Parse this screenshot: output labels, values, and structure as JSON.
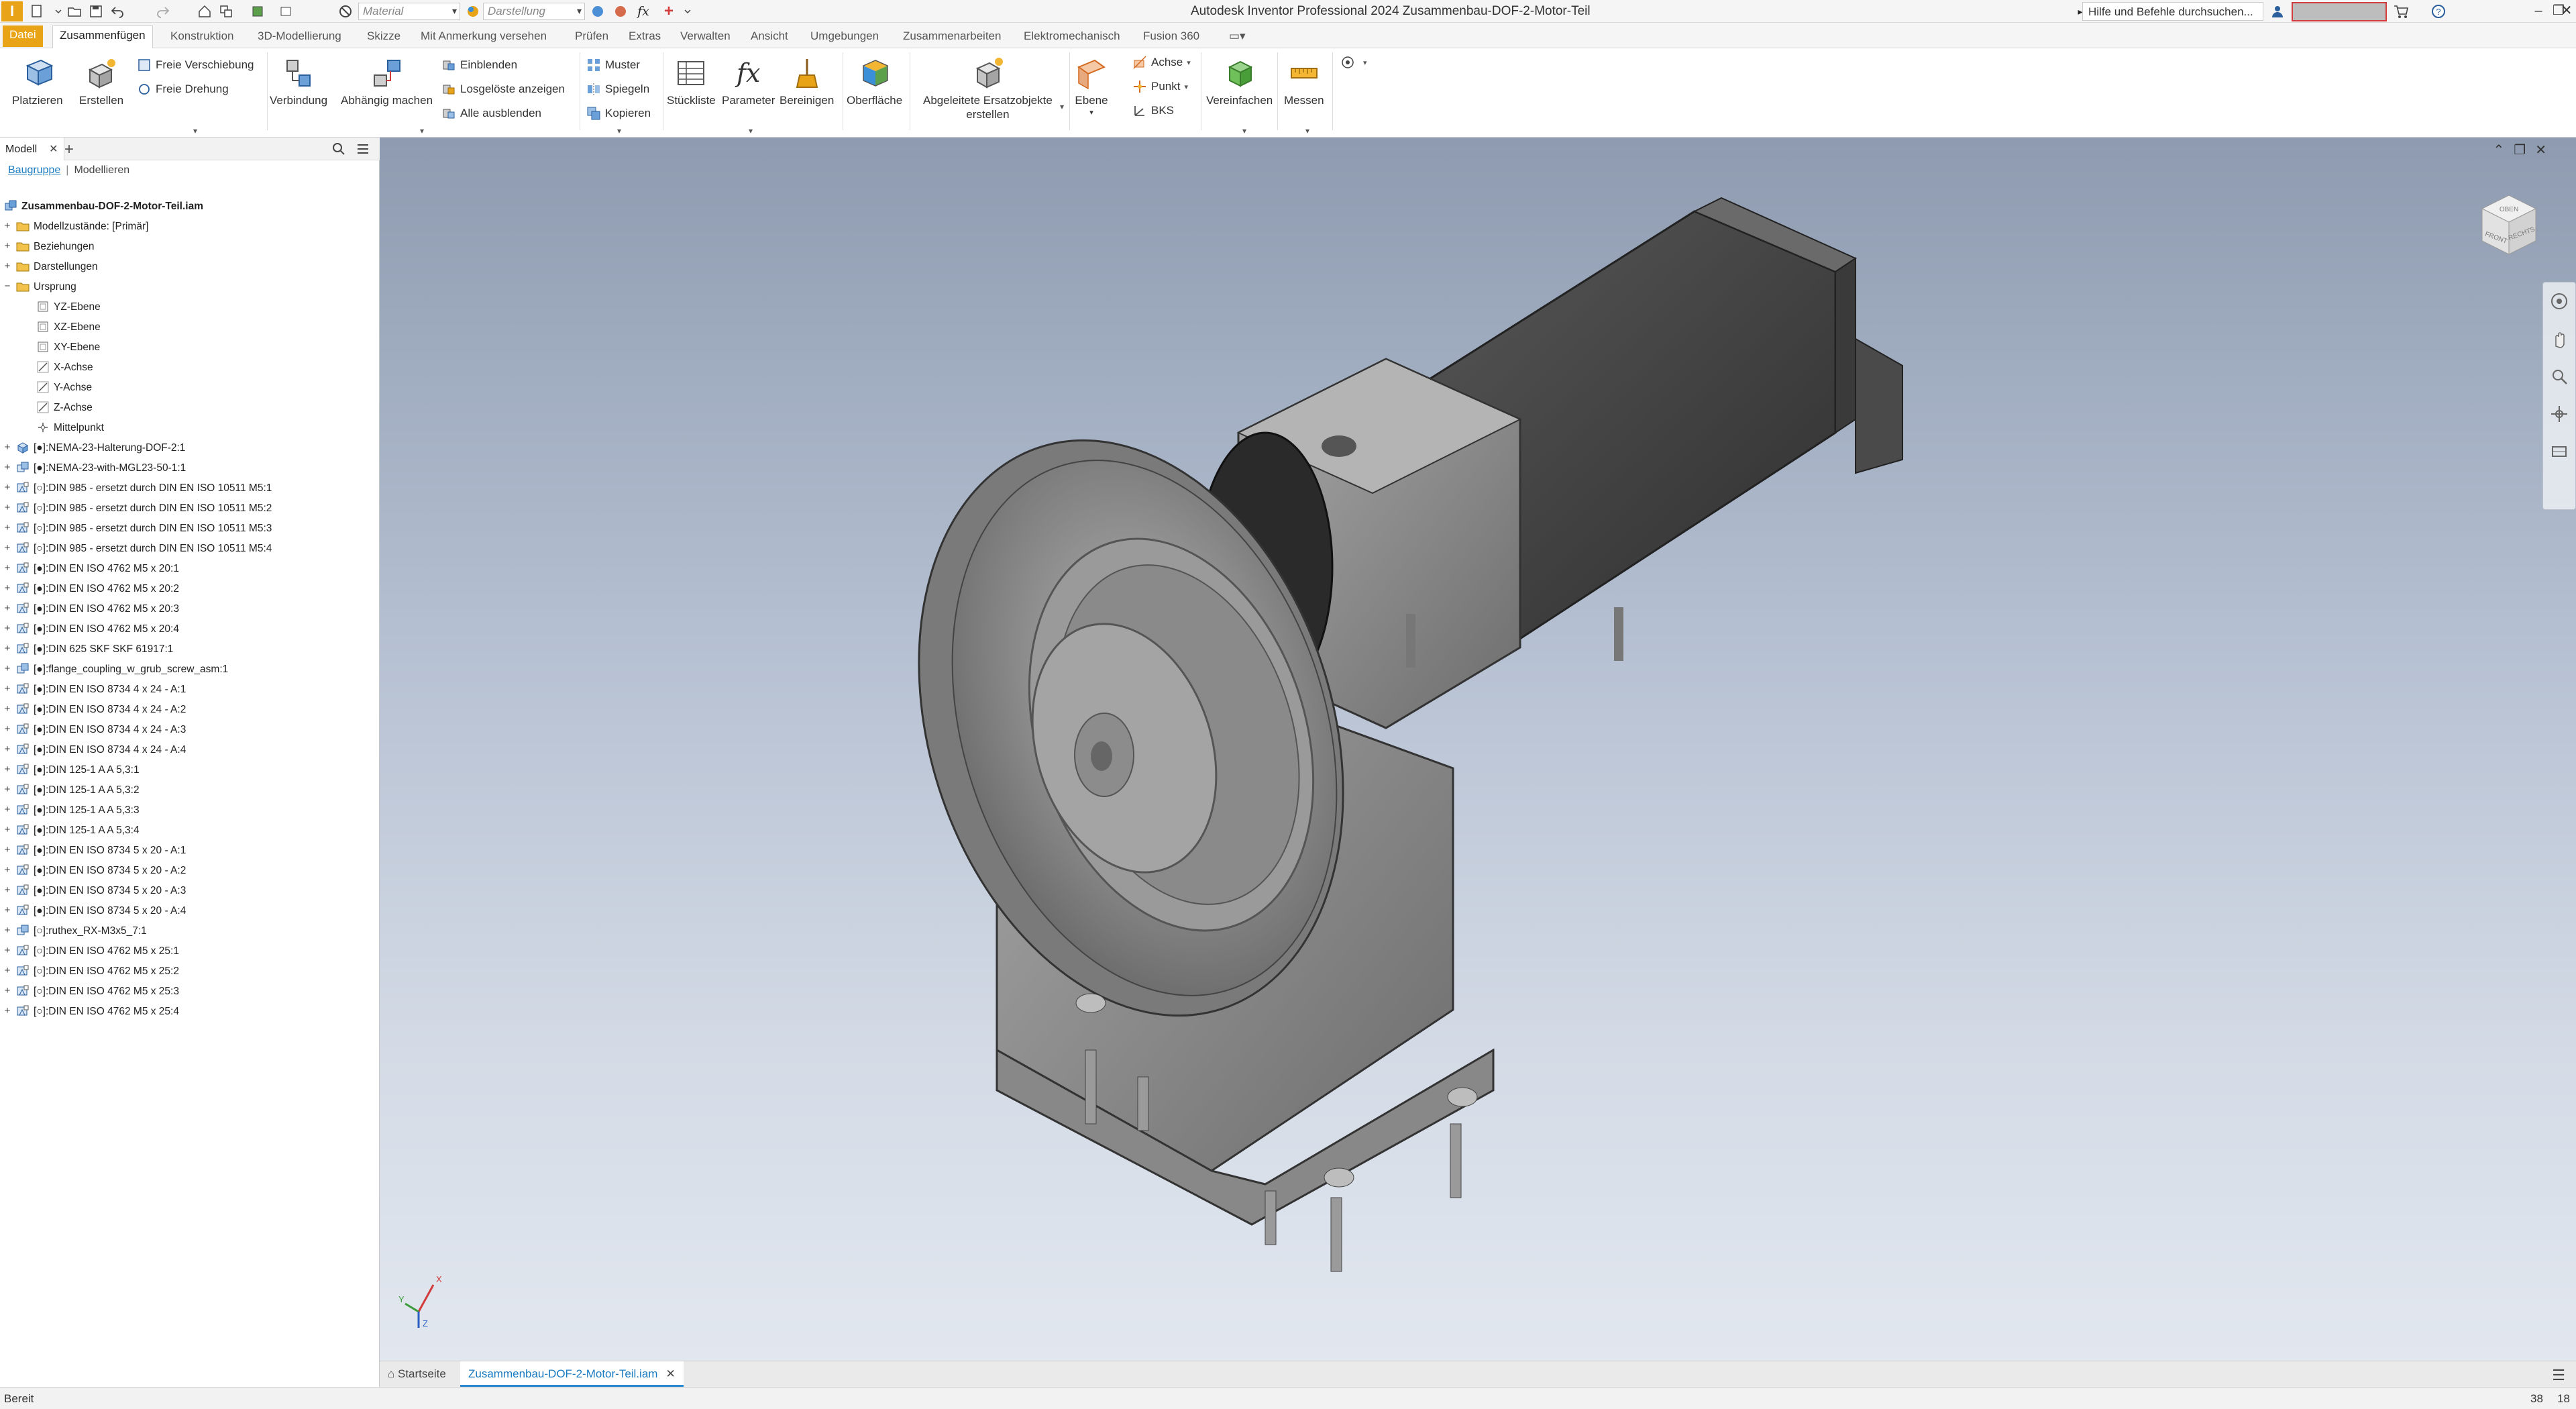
{
  "app": {
    "logo_letter": "I",
    "window_title": "Autodesk Inventor Professional 2024   Zusammenbau-DOF-2-Motor-Teil",
    "material_combo": "Material",
    "appearance_combo": "Darstellung",
    "help_search_placeholder": "Hilfe und Befehle durchsuchen...",
    "accent_color": "#e8a317"
  },
  "tabs": [
    "Datei",
    "Zusammenfügen",
    "Konstruktion",
    "3D-Modellierung",
    "Skizze",
    "Mit Anmerkung versehen",
    "Prüfen",
    "Extras",
    "Verwalten",
    "Ansicht",
    "Umgebungen",
    "Zusammenarbeiten",
    "Elektromechanisch",
    "Fusion 360"
  ],
  "active_tab": "Zusammenfügen",
  "ribbon": {
    "platzieren": "Platzieren",
    "erstellen": "Erstellen",
    "freie_verschiebung": "Freie Verschiebung",
    "freie_drehung": "Freie Drehung",
    "verbindung": "Verbindung",
    "abhaengig_machen": "Abhängig machen",
    "einblenden": "Einblenden",
    "losgeloeste": "Losgelöste anzeigen",
    "alle_ausblenden": "Alle ausblenden",
    "muster": "Muster",
    "spiegeln": "Spiegeln",
    "kopieren": "Kopieren",
    "stueckliste": "Stückliste",
    "parameter": "Parameter",
    "bereinigen": "Bereinigen",
    "oberflaeche": "Oberfläche",
    "ersatz_line1": "Abgeleitete Ersatzobjekte",
    "ersatz_line2": "erstellen",
    "ebene": "Ebene",
    "achse": "Achse",
    "punkt": "Punkt",
    "bks": "BKS",
    "vereinfachen": "Vereinfachen",
    "messen": "Messen"
  },
  "browser": {
    "tab_label": "Modell",
    "sub_baugruppe": "Baugruppe",
    "sub_modellieren": "Modellieren",
    "tree": [
      {
        "label": "Zusammenbau-DOF-2-Motor-Teil.iam",
        "level": 0,
        "icon": "assembly-icon",
        "exp": ""
      },
      {
        "label": "Modellzustände: [Primär]",
        "level": 1,
        "icon": "folder-icon",
        "exp": "+"
      },
      {
        "label": "Beziehungen",
        "level": 1,
        "icon": "folder-icon",
        "exp": "+"
      },
      {
        "label": "Darstellungen",
        "level": 1,
        "icon": "folder-icon",
        "exp": "+"
      },
      {
        "label": "Ursprung",
        "level": 1,
        "icon": "folder-icon",
        "exp": "−"
      },
      {
        "label": "YZ-Ebene",
        "level": 2,
        "icon": "plane-icon",
        "exp": ""
      },
      {
        "label": "XZ-Ebene",
        "level": 2,
        "icon": "plane-icon",
        "exp": ""
      },
      {
        "label": "XY-Ebene",
        "level": 2,
        "icon": "plane-icon",
        "exp": ""
      },
      {
        "label": "X-Achse",
        "level": 2,
        "icon": "axis-icon",
        "exp": ""
      },
      {
        "label": "Y-Achse",
        "level": 2,
        "icon": "axis-icon",
        "exp": ""
      },
      {
        "label": "Z-Achse",
        "level": 2,
        "icon": "axis-icon",
        "exp": ""
      },
      {
        "label": "Mittelpunkt",
        "level": 2,
        "icon": "point-icon",
        "exp": ""
      },
      {
        "label": "[●]:NEMA-23-Halterung-DOF-2:1",
        "level": 1,
        "icon": "part-icon",
        "exp": "+"
      },
      {
        "label": "[●]:NEMA-23-with-MGL23-50-1:1",
        "level": 1,
        "icon": "subassembly-icon",
        "exp": "+"
      },
      {
        "label": "[○]:DIN 985 - ersetzt durch DIN EN ISO 10511 M5:1",
        "level": 1,
        "icon": "library-part-icon",
        "exp": "+"
      },
      {
        "label": "[○]:DIN 985 - ersetzt durch DIN EN ISO 10511 M5:2",
        "level": 1,
        "icon": "library-part-icon",
        "exp": "+"
      },
      {
        "label": "[○]:DIN 985 - ersetzt durch DIN EN ISO 10511 M5:3",
        "level": 1,
        "icon": "library-part-icon",
        "exp": "+"
      },
      {
        "label": "[○]:DIN 985 - ersetzt durch DIN EN ISO 10511 M5:4",
        "level": 1,
        "icon": "library-part-icon",
        "exp": "+"
      },
      {
        "label": "[●]:DIN EN ISO 4762 M5 x 20:1",
        "level": 1,
        "icon": "library-part-icon",
        "exp": "+"
      },
      {
        "label": "[●]:DIN EN ISO 4762 M5 x 20:2",
        "level": 1,
        "icon": "library-part-icon",
        "exp": "+"
      },
      {
        "label": "[●]:DIN EN ISO 4762 M5 x 20:3",
        "level": 1,
        "icon": "library-part-icon",
        "exp": "+"
      },
      {
        "label": "[●]:DIN EN ISO 4762 M5 x 20:4",
        "level": 1,
        "icon": "library-part-icon",
        "exp": "+"
      },
      {
        "label": "[●]:DIN 625 SKF SKF 61917:1",
        "level": 1,
        "icon": "library-part-icon",
        "exp": "+"
      },
      {
        "label": "[●]:flange_coupling_w_grub_screw_asm:1",
        "level": 1,
        "icon": "subassembly-icon",
        "exp": "+"
      },
      {
        "label": "[●]:DIN EN ISO 8734 4 x 24 - A:1",
        "level": 1,
        "icon": "library-part-icon",
        "exp": "+"
      },
      {
        "label": "[●]:DIN EN ISO 8734 4 x 24 - A:2",
        "level": 1,
        "icon": "library-part-icon",
        "exp": "+"
      },
      {
        "label": "[●]:DIN EN ISO 8734 4 x 24 - A:3",
        "level": 1,
        "icon": "library-part-icon",
        "exp": "+"
      },
      {
        "label": "[●]:DIN EN ISO 8734 4 x 24 - A:4",
        "level": 1,
        "icon": "library-part-icon",
        "exp": "+"
      },
      {
        "label": "[●]:DIN 125-1 A A 5,3:1",
        "level": 1,
        "icon": "library-part-icon",
        "exp": "+"
      },
      {
        "label": "[●]:DIN 125-1 A A 5,3:2",
        "level": 1,
        "icon": "library-part-icon",
        "exp": "+"
      },
      {
        "label": "[●]:DIN 125-1 A A 5,3:3",
        "level": 1,
        "icon": "library-part-icon",
        "exp": "+"
      },
      {
        "label": "[●]:DIN 125-1 A A 5,3:4",
        "level": 1,
        "icon": "library-part-icon",
        "exp": "+"
      },
      {
        "label": "[●]:DIN EN ISO 8734 5 x 20 - A:1",
        "level": 1,
        "icon": "library-part-icon",
        "exp": "+"
      },
      {
        "label": "[●]:DIN EN ISO 8734 5 x 20 - A:2",
        "level": 1,
        "icon": "library-part-icon",
        "exp": "+"
      },
      {
        "label": "[●]:DIN EN ISO 8734 5 x 20 - A:3",
        "level": 1,
        "icon": "library-part-icon",
        "exp": "+"
      },
      {
        "label": "[●]:DIN EN ISO 8734 5 x 20 - A:4",
        "level": 1,
        "icon": "library-part-icon",
        "exp": "+"
      },
      {
        "label": "[○]:ruthex_RX-M3x5_7:1",
        "level": 1,
        "icon": "subassembly-icon",
        "exp": "+"
      },
      {
        "label": "[○]:DIN EN ISO 4762 M5 x 25:1",
        "level": 1,
        "icon": "library-part-icon",
        "exp": "+"
      },
      {
        "label": "[○]:DIN EN ISO 4762 M5 x 25:2",
        "level": 1,
        "icon": "library-part-icon",
        "exp": "+"
      },
      {
        "label": "[○]:DIN EN ISO 4762 M5 x 25:3",
        "level": 1,
        "icon": "library-part-icon",
        "exp": "+"
      },
      {
        "label": "[○]:DIN EN ISO 4762 M5 x 25:4",
        "level": 1,
        "icon": "library-part-icon",
        "exp": "+"
      }
    ]
  },
  "viewcube": {
    "front_label": "FRONT",
    "top_label": "OBEN",
    "right_label": "RECHTS"
  },
  "triad": {
    "x_label": "X",
    "y_label": "Y",
    "z_label": "Z"
  },
  "doctabs": {
    "home": "Startseite",
    "active": "Zusammenbau-DOF-2-Motor-Teil.iam"
  },
  "status": {
    "text": "Bereit",
    "n1": "38",
    "n2": "18"
  }
}
